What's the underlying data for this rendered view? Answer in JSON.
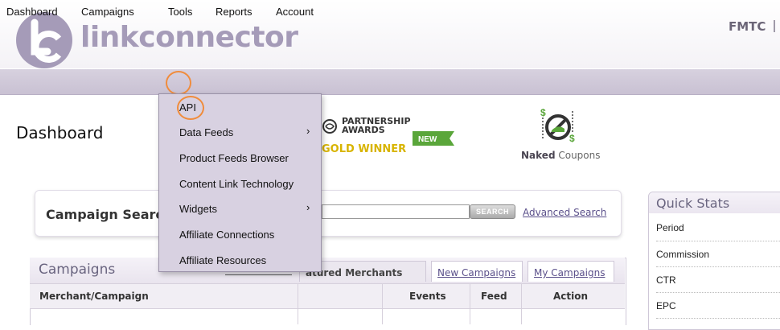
{
  "header": {
    "brand": "linkconnector",
    "account": "FMTC"
  },
  "nav": {
    "items": [
      "Dashboard",
      "Campaigns",
      "Tools",
      "Reports",
      "Account"
    ]
  },
  "tools_menu": {
    "items": [
      {
        "label": "API",
        "submenu": false
      },
      {
        "label": "Data Feeds",
        "submenu": true
      },
      {
        "label": "Product Feeds Browser",
        "submenu": false
      },
      {
        "label": "Content Link Technology",
        "submenu": false
      },
      {
        "label": "Widgets",
        "submenu": true
      },
      {
        "label": "Affiliate Connections",
        "submenu": false
      },
      {
        "label": "Affiliate Resources",
        "submenu": false
      }
    ],
    "submenu_arrow": "›"
  },
  "page": {
    "title": "Dashboard"
  },
  "promo": {
    "partnership_line1": "PARTNERSHIP",
    "partnership_line2": "AWARDS",
    "gold_winner": "GOLD WINNER",
    "new_badge": "NEW",
    "naked_bold": "Naked",
    "naked_rest": " Coupons"
  },
  "campaign_search": {
    "title": "Campaign Searc",
    "input_value": "",
    "search_button": "SEARCH",
    "advanced_link": "Advanced Search"
  },
  "campaigns": {
    "title": "Campaigns",
    "tabs": [
      "atured Merchants",
      "New Campaigns",
      "My Campaigns"
    ],
    "columns": [
      "Merchant/Campaign",
      "Events",
      "Feed",
      "Action"
    ]
  },
  "quick_stats": {
    "title": "Quick Stats",
    "rows": [
      "Period",
      "Commission",
      "CTR",
      "EPC"
    ]
  },
  "colors": {
    "brand": "#a59bb8",
    "highlight_circle": "#f08c3c",
    "menu_bg": "#d8d1e1",
    "gold": "#d8b400",
    "new_green": "#5aa63a",
    "link": "#5a4f8a"
  }
}
